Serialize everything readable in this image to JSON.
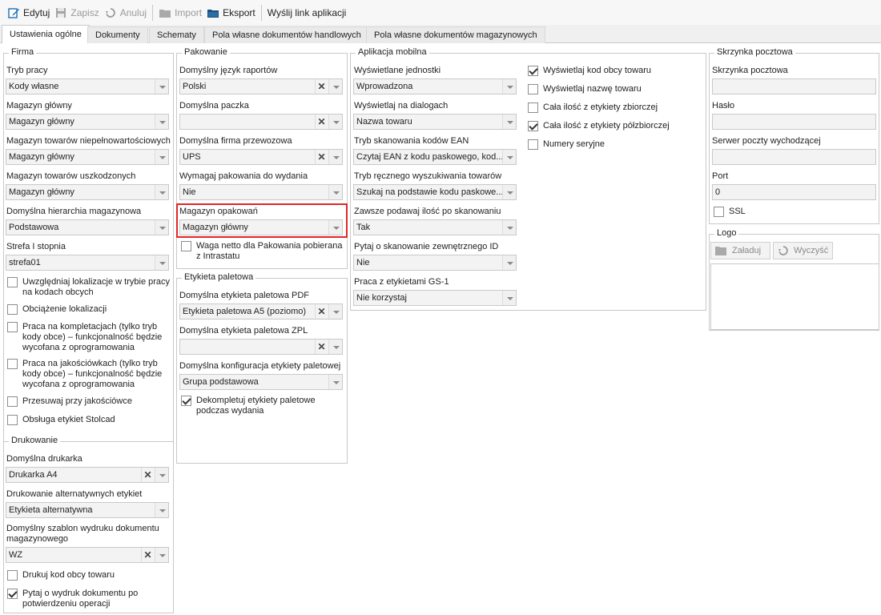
{
  "toolbar": {
    "edit": "Edytuj",
    "save": "Zapisz",
    "cancel": "Anuluj",
    "import": "Import",
    "export": "Eksport",
    "send_link": "Wyślij link aplikacji"
  },
  "tabs": [
    "Ustawienia ogólne",
    "Dokumenty",
    "Schematy",
    "Pola własne dokumentów handlowych",
    "Pola własne dokumentów magazynowych"
  ],
  "firma": {
    "title": "Firma",
    "tryb_pracy": {
      "label": "Tryb pracy",
      "value": "Kody własne"
    },
    "magazyn_glowny": {
      "label": "Magazyn główny",
      "value": "Magazyn główny"
    },
    "magazyn_niepelnowart": {
      "label": "Magazyn towarów niepełnowartościowych",
      "value": "Magazyn główny"
    },
    "magazyn_uszk": {
      "label": "Magazyn towarów uszkodzonych",
      "value": "Magazyn główny"
    },
    "hierarchia": {
      "label": "Domyślna hierarchia magazynowa",
      "value": "Podstawowa"
    },
    "strefa": {
      "label": "Strefa I stopnia",
      "value": "strefa01"
    },
    "chk1": "Uwzględniaj lokalizacje w trybie pracy na kodach obcych",
    "chk2": "Obciążenie lokalizacji",
    "chk3": "Praca na kompletacjach (tylko tryb kody obce) – funkcjonalność będzie wycofana z oprogramowania",
    "chk4": "Praca na jakościówkach (tylko tryb kody obce) – funkcjonalność będzie wycofana z oprogramowania",
    "chk5": "Przesuwaj przy jakościówce",
    "chk6": "Obsługa etykiet Stolcad"
  },
  "drukowanie": {
    "title": "Drukowanie",
    "drukarka": {
      "label": "Domyślna drukarka",
      "value": "Drukarka A4"
    },
    "alt": {
      "label": "Drukowanie alternatywnych etykiet",
      "value": "Etykieta alternatywna"
    },
    "szablon": {
      "label": "Domyślny szablon wydruku dokumentu magazynowego",
      "value": "WZ"
    },
    "chk1": "Drukuj kod obcy towaru",
    "chk2": "Pytaj o wydruk dokumentu po potwierdzeniu operacji"
  },
  "pakowanie": {
    "title": "Pakowanie",
    "jezyk": {
      "label": "Domyślny język raportów",
      "value": "Polski"
    },
    "paczka": {
      "label": "Domyślna paczka",
      "value": ""
    },
    "firma": {
      "label": "Domyślna firma przewozowa",
      "value": "UPS"
    },
    "wymagaj": {
      "label": "Wymagaj pakowania do wydania",
      "value": "Nie"
    },
    "magazyn": {
      "label": "Magazyn opakowań",
      "value": "Magazyn główny"
    },
    "chk1": "Waga netto dla Pakowania pobierana z Intrastatu"
  },
  "etykieta": {
    "title": "Etykieta paletowa",
    "pdf": {
      "label": "Domyślna etykieta paletowa PDF",
      "value": "Etykieta paletowa A5 (poziomo)"
    },
    "zpl": {
      "label": "Domyślna etykieta paletowa ZPL",
      "value": ""
    },
    "konf": {
      "label": "Domyślna konfiguracja etykiety paletowej",
      "value": "Grupa podstawowa"
    },
    "chk1": "Dekompletuj etykiety paletowe podczas wydania"
  },
  "aplikacja": {
    "title": "Aplikacja mobilna",
    "jednostki": {
      "label": "Wyświetlane jednostki",
      "value": "Wprowadzona"
    },
    "dialogi": {
      "label": "Wyświetlaj na dialogach",
      "value": "Nazwa towaru"
    },
    "ean": {
      "label": "Tryb skanowania kodów EAN",
      "value": "Czytaj EAN z kodu paskowego, kod..."
    },
    "reczny": {
      "label": "Tryb ręcznego wyszukiwania towarów",
      "value": "Szukaj na podstawie kodu paskowe..."
    },
    "ilosc": {
      "label": "Zawsze podawaj ilość po skanowaniu",
      "value": "Tak"
    },
    "zewn": {
      "label": "Pytaj o skanowanie zewnętrznego ID",
      "value": "Nie"
    },
    "gs1": {
      "label": "Praca z etykietami GS-1",
      "value": "Nie korzystaj"
    },
    "chk1": "Wyświetlaj kod obcy towaru",
    "chk2": "Wyświetlaj nazwę towaru",
    "chk3": "Cała ilość z etykiety zbiorczej",
    "chk4": "Cała ilość z etykiety półzbiorczej",
    "chk5": "Numery seryjne"
  },
  "skrzynka": {
    "title": "Skrzynka pocztowa",
    "skrzynka": {
      "label": "Skrzynka pocztowa",
      "value": ""
    },
    "haslo": {
      "label": "Hasło",
      "value": ""
    },
    "serwer": {
      "label": "Serwer poczty wychodzącej",
      "value": ""
    },
    "port": {
      "label": "Port",
      "value": "0"
    },
    "ssl": "SSL"
  },
  "logo": {
    "title": "Logo",
    "load": "Załaduj",
    "clear": "Wyczyść"
  },
  "colors": {
    "highlight": "#e0262a",
    "check": "#333333"
  }
}
